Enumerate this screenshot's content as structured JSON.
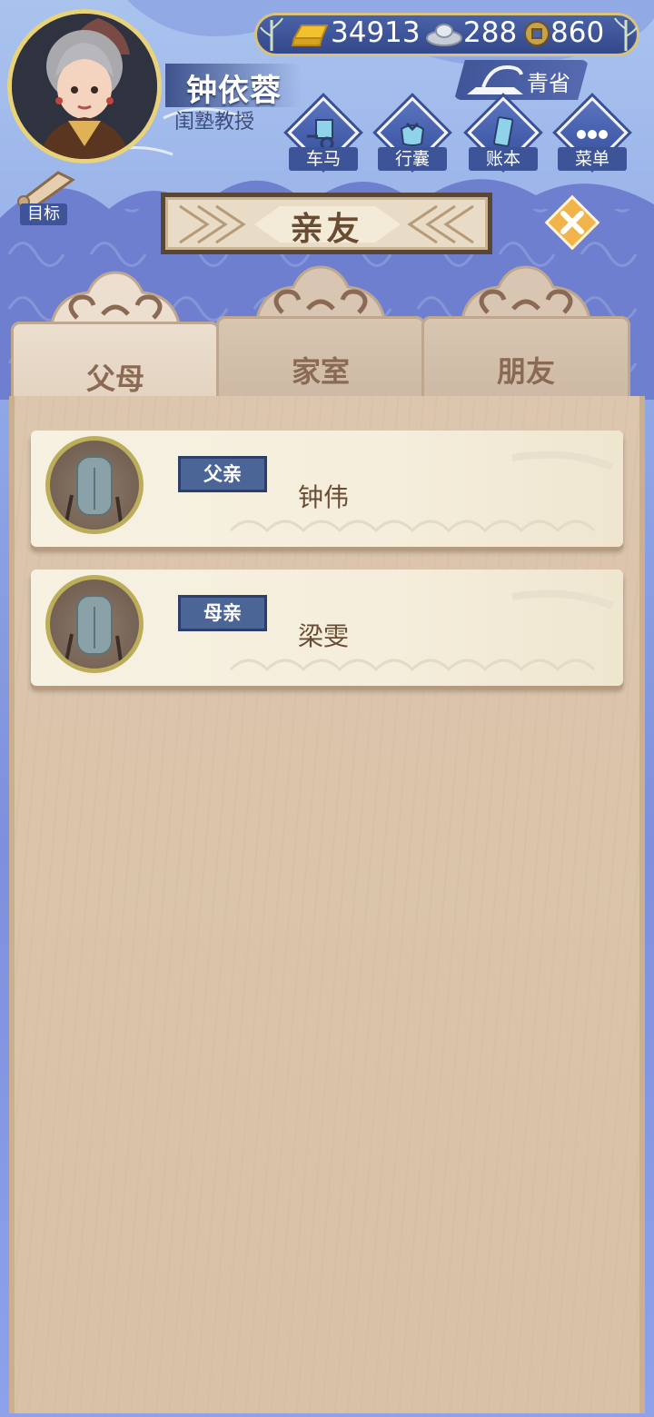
{
  "player": {
    "name": "钟依蓉",
    "title": "闺塾教授"
  },
  "currency": {
    "gold": "34913",
    "silver": "288",
    "coins": "860"
  },
  "region": "青省",
  "menu": [
    {
      "label": "车马",
      "icon": "carriage-icon"
    },
    {
      "label": "行囊",
      "icon": "bundle-icon"
    },
    {
      "label": "账本",
      "icon": "ledger-icon"
    },
    {
      "label": "菜单",
      "icon": "more-icon"
    }
  ],
  "goal_label": "目标",
  "page_title": "亲友",
  "tabs": [
    {
      "label": "父母",
      "active": true
    },
    {
      "label": "家室",
      "active": false
    },
    {
      "label": "朋友",
      "active": false
    }
  ],
  "relatives": [
    {
      "relation": "父亲",
      "name": "钟伟"
    },
    {
      "relation": "母亲",
      "name": "梁雯"
    }
  ],
  "colors": {
    "accent_blue": "#4b6597",
    "text_brown": "#6a4b33",
    "gold": "#e8d27a"
  }
}
